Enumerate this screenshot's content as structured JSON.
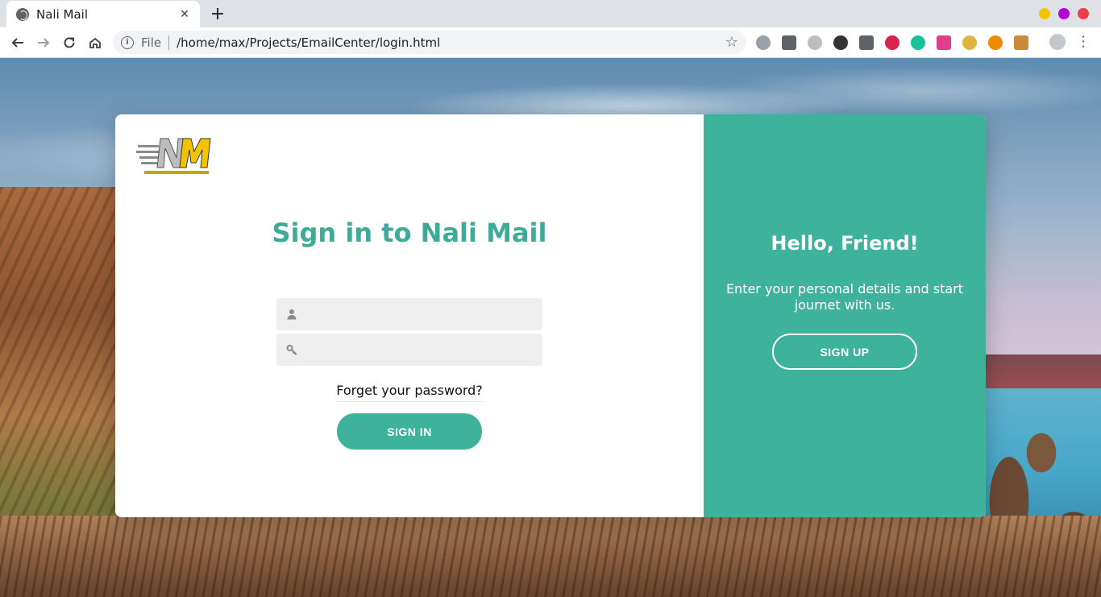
{
  "browser": {
    "tab_title": "Nali Mail",
    "tab_close": "✕",
    "new_tab": "+",
    "scheme_label": "File",
    "url": "/home/max/Projects/EmailCenter/login.html",
    "info_icon_glyph": "i",
    "star_glyph": "☆",
    "menu_glyph": "⋮",
    "window_controls": {
      "minimize": "#f5c400",
      "maximize": "#b400d6",
      "close": "#ef3d4a"
    },
    "extensions": [
      {
        "name": "camera-extension-icon",
        "color": "#9aa0a6"
      },
      {
        "name": "layers-extension-icon",
        "color": "#5f6368"
      },
      {
        "name": "swirl-extension-icon",
        "color": "#bdbdbd"
      },
      {
        "name": "github-extension-icon",
        "color": "#333333"
      },
      {
        "name": "eye-extension-icon",
        "color": "#5f6368"
      },
      {
        "name": "blocker-extension-icon",
        "color": "#d8244a"
      },
      {
        "name": "grammarly-extension-icon",
        "color": "#15c39a"
      },
      {
        "name": "moon-extension-icon",
        "color": "#e0408a"
      },
      {
        "name": "taco-extension-icon",
        "color": "#e0b340"
      },
      {
        "name": "honey-extension-icon",
        "color": "#f08a00"
      },
      {
        "name": "cookie-extension-icon",
        "color": "#c98a3a"
      }
    ]
  },
  "login": {
    "title": "Sign in to Nali Mail",
    "username_placeholder": "",
    "password_placeholder": "",
    "forgot_password": "Forget your password?",
    "signin_button": "SIGN IN"
  },
  "promo": {
    "title": "Hello, Friend!",
    "text": "Enter your personal details and start journet with us.",
    "signup_button": "SIGN UP"
  },
  "colors": {
    "accent": "#3eb29a",
    "title": "#3eaa98",
    "field_bg": "#eeeeee"
  }
}
